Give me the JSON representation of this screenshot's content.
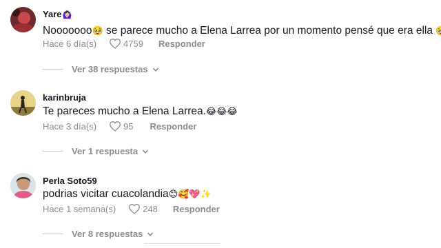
{
  "comments": [
    {
      "username": "Yare",
      "username_emoji": "🙆🏻‍♀️",
      "text": "Nooooooo",
      "text_emoji_1": "🥹",
      "text_rest": " se parece mucho a Elena Larrea por un momento pensé que era ella ",
      "text_emoji_2": "🥹",
      "time": "Hace 6 día(s)",
      "likes": "4759",
      "reply_label": "Responder",
      "view_replies": "Ver 38 respuestas",
      "avatar_icon": "avatar-photo-red"
    },
    {
      "username": "karinbruja",
      "text": "Te pareces mucho a Elena Larrea.",
      "text_emoji": "😂😂😂",
      "time": "Hace 3 día(s)",
      "likes": "95",
      "reply_label": "Responder",
      "view_replies": "Ver 1 respuesta",
      "avatar_icon": "avatar-photo-silhouette"
    },
    {
      "username": "Perla Soto59",
      "text": "podrias vicitar cuacolandia",
      "text_emoji": "😊🥰💖✨",
      "time": "Hace 1 semana(s)",
      "likes": "248",
      "reply_label": "Responder",
      "view_replies": "Ver 8 respuestas",
      "avatar_icon": "avatar-photo-woman"
    }
  ],
  "icons": {
    "like": "heart-outline-icon",
    "chevron": "chevron-down-icon"
  },
  "colors": {
    "text": "#161823",
    "muted": "#8a8b91",
    "divider": "#c9cace"
  }
}
